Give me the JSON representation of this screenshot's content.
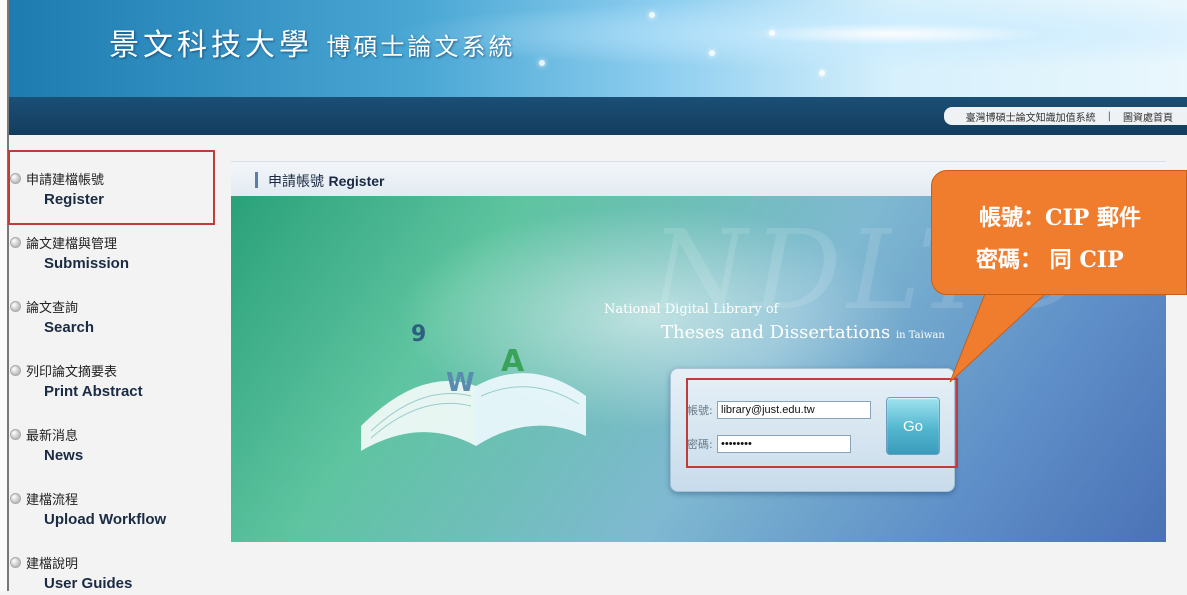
{
  "header": {
    "title": "景文科技大學",
    "subtitle": "博碩士論文系統",
    "nav_links": [
      "臺灣博碩士論文知識加值系統",
      "圖資處首頁"
    ]
  },
  "sidebar": {
    "items": [
      {
        "cn": "申請建檔帳號",
        "en": "Register"
      },
      {
        "cn": "論文建檔與管理",
        "en": "Submission"
      },
      {
        "cn": "論文查詢",
        "en": "Search"
      },
      {
        "cn": "列印論文摘要表",
        "en": "Print Abstract"
      },
      {
        "cn": "最新消息",
        "en": "News"
      },
      {
        "cn": "建檔流程",
        "en": "Upload Workflow"
      },
      {
        "cn": "建檔說明",
        "en": "User Guides"
      }
    ]
  },
  "content": {
    "heading_cn": "申請帳號",
    "heading_en": "Register"
  },
  "banner": {
    "watermark": "NDLTD",
    "line1": "National Digital Library of",
    "line2": "Theses and Dissertations",
    "line2_small": "in Taiwan"
  },
  "login": {
    "account_label": "帳號:",
    "account_value": "library@just.edu.tw",
    "password_label": "密碼:",
    "password_value": "••••••••",
    "go_label": "Go"
  },
  "callout": {
    "line1": "帳號：CIP 郵件",
    "line2": "密碼： 同 CIP"
  },
  "colors": {
    "accent": "#f07d2e",
    "highlight_border": "#c23b3b",
    "nav_bar": "#1b4f76"
  }
}
